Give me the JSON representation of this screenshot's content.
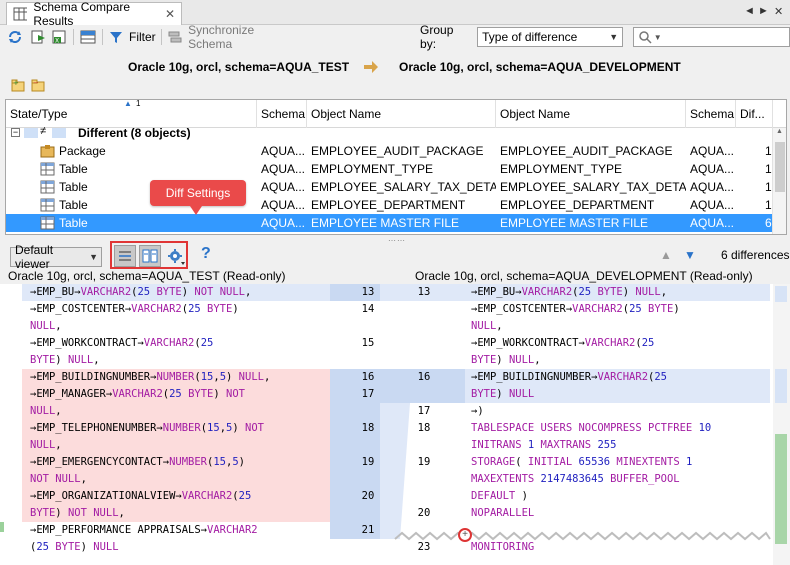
{
  "tab": {
    "title": "Schema Compare Results",
    "icon": "table-icon",
    "close": "✕"
  },
  "window_controls": {
    "prev": "◄",
    "next": "►",
    "close": "✕"
  },
  "toolbar": {
    "filter_label": "Filter",
    "sync_label": "Synchronize Schema",
    "group_by_label": "Group by:",
    "group_by_value": "Type of difference",
    "search_placeholder": ""
  },
  "connections": {
    "left": "Oracle 10g, orcl,  schema=AQUA_TEST",
    "right": "Oracle 10g, orcl,  schema=AQUA_DEVELOPMENT"
  },
  "grid": {
    "sort_indicator": "1",
    "columns": [
      "State/Type",
      "Schema",
      "Object Name",
      "Object Name",
      "Schema",
      "Dif..."
    ],
    "group": {
      "label": "Different (8 objects)"
    },
    "rows": [
      {
        "type": "Package",
        "schema": "AQUA...",
        "left": "EMPLOYEE_AUDIT_PACKAGE",
        "right": "EMPLOYEE_AUDIT_PACKAGE",
        "schema2": "AQUA...",
        "diff": "1"
      },
      {
        "type": "Table",
        "schema": "AQUA...",
        "left": "EMPLOYMENT_TYPE",
        "right": "EMPLOYMENT_TYPE",
        "schema2": "AQUA...",
        "diff": "1"
      },
      {
        "type": "Table",
        "schema": "AQUA...",
        "left": "EMPLOYEE_SALARY_TAX_DETAILS",
        "right": "EMPLOYEE_SALARY_TAX_DETAILS",
        "schema2": "AQUA...",
        "diff": "1"
      },
      {
        "type": "Table",
        "schema": "AQUA...",
        "left": "EMPLOYEE_DEPARTMENT",
        "right": "EMPLOYEE_DEPARTMENT",
        "schema2": "AQUA...",
        "diff": "1"
      },
      {
        "type": "Table",
        "schema": "AQUA...",
        "left": "EMPLOYEE MASTER FILE",
        "right": "EMPLOYEE MASTER FILE",
        "schema2": "AQUA...",
        "diff": "6"
      }
    ]
  },
  "callout": {
    "label": "Diff Settings"
  },
  "viewer": {
    "select_value": "Default viewer",
    "help": "?",
    "differences": "6 differences"
  },
  "panes": {
    "left_header": "Oracle 10g, orcl, schema=AQUA_TEST (Read-only)",
    "right_header": "Oracle 10g, orcl, schema=AQUA_DEVELOPMENT (Read-only)"
  },
  "diff": {
    "left_lines": [
      [
        [
          "→EMP_BU→",
          "pl"
        ],
        [
          "VARCHAR2",
          "kw"
        ],
        [
          "(",
          "pl"
        ],
        [
          "25",
          "nm"
        ],
        [
          " BYTE",
          "kw"
        ],
        [
          ") ",
          "pl"
        ],
        [
          "NOT NULL",
          "kw"
        ],
        [
          ",",
          "pl"
        ]
      ],
      [
        [
          "→EMP_COSTCENTER→",
          "pl"
        ],
        [
          "VARCHAR2",
          "kw"
        ],
        [
          "(",
          "pl"
        ],
        [
          "25",
          "nm"
        ],
        [
          " BYTE",
          "kw"
        ],
        [
          ")",
          "pl"
        ]
      ],
      [
        [
          "NULL",
          "kw"
        ],
        [
          ",",
          "pl"
        ]
      ],
      [
        [
          "→EMP_WORKCONTRACT→",
          "pl"
        ],
        [
          "VARCHAR2",
          "kw"
        ],
        [
          "(",
          "pl"
        ],
        [
          "25",
          "nm"
        ]
      ],
      [
        [
          "BYTE",
          "kw"
        ],
        [
          ") ",
          "pl"
        ],
        [
          "NULL",
          "kw"
        ],
        [
          ",",
          "pl"
        ]
      ],
      [
        [
          "→EMP_BUILDINGNUMBER→",
          "pl"
        ],
        [
          "NUMBER",
          "kw"
        ],
        [
          "(",
          "pl"
        ],
        [
          "15",
          "nm"
        ],
        [
          ",",
          "pl"
        ],
        [
          "5",
          "nm"
        ],
        [
          ") ",
          "pl"
        ],
        [
          "NULL",
          "kw"
        ],
        [
          ",",
          "pl"
        ]
      ],
      [
        [
          "→EMP_MANAGER→",
          "pl"
        ],
        [
          "VARCHAR2",
          "kw"
        ],
        [
          "(",
          "pl"
        ],
        [
          "25",
          "nm"
        ],
        [
          " BYTE",
          "kw"
        ],
        [
          ") ",
          "pl"
        ],
        [
          "NOT",
          "kw"
        ]
      ],
      [
        [
          "NULL",
          "kw"
        ],
        [
          ",",
          "pl"
        ]
      ],
      [
        [
          "→EMP_TELEPHONENUMBER→",
          "pl"
        ],
        [
          "NUMBER",
          "kw"
        ],
        [
          "(",
          "pl"
        ],
        [
          "15",
          "nm"
        ],
        [
          ",",
          "pl"
        ],
        [
          "5",
          "nm"
        ],
        [
          ") ",
          "pl"
        ],
        [
          "NOT",
          "kw"
        ]
      ],
      [
        [
          "NULL",
          "kw"
        ],
        [
          ",",
          "pl"
        ]
      ],
      [
        [
          "→EMP_EMERGENCYCONTACT→",
          "pl"
        ],
        [
          "NUMBER",
          "kw"
        ],
        [
          "(",
          "pl"
        ],
        [
          "15",
          "nm"
        ],
        [
          ",",
          "pl"
        ],
        [
          "5",
          "nm"
        ],
        [
          ")",
          "pl"
        ]
      ],
      [
        [
          "NOT NULL",
          "kw"
        ],
        [
          ",",
          "pl"
        ]
      ],
      [
        [
          "→EMP_ORGANIZATIONALVIEW→",
          "pl"
        ],
        [
          "VARCHAR2",
          "kw"
        ],
        [
          "(",
          "pl"
        ],
        [
          "25",
          "nm"
        ]
      ],
      [
        [
          "BYTE",
          "kw"
        ],
        [
          ") ",
          "pl"
        ],
        [
          "NOT NULL",
          "kw"
        ],
        [
          ",",
          "pl"
        ]
      ],
      [
        [
          "→EMP_PERFORMANCE APPRAISALS→",
          "pl"
        ],
        [
          "VARCHAR2",
          "kw"
        ]
      ],
      [
        [
          "(",
          "pl"
        ],
        [
          "25",
          "nm"
        ],
        [
          " BYTE",
          "kw"
        ],
        [
          ") ",
          "pl"
        ],
        [
          "NULL",
          "kw"
        ]
      ]
    ],
    "left_numbers": [
      "13",
      "14",
      "",
      "15",
      "",
      "16",
      "17",
      "",
      "18",
      "",
      "19",
      "",
      "20",
      "",
      "21",
      ""
    ],
    "right_numbers": [
      "13",
      "",
      "",
      "",
      "",
      "16",
      "",
      "17",
      "18",
      "",
      "19",
      "",
      "",
      "20",
      "",
      "23"
    ],
    "right_lines": [
      [
        [
          "→EMP_BU→",
          "pl"
        ],
        [
          "VARCHAR2",
          "kw"
        ],
        [
          "(",
          "pl"
        ],
        [
          "25",
          "nm"
        ],
        [
          " BYTE",
          "kw"
        ],
        [
          ") ",
          "pl"
        ],
        [
          "NULL",
          "kw"
        ],
        [
          ",",
          "pl"
        ]
      ],
      [
        [
          "→EMP_COSTCENTER→",
          "pl"
        ],
        [
          "VARCHAR2",
          "kw"
        ],
        [
          "(",
          "pl"
        ],
        [
          "25",
          "nm"
        ],
        [
          " BYTE",
          "kw"
        ],
        [
          ")",
          "pl"
        ]
      ],
      [
        [
          "NULL",
          "kw"
        ],
        [
          ",",
          "pl"
        ]
      ],
      [
        [
          "→EMP_WORKCONTRACT→",
          "pl"
        ],
        [
          "VARCHAR2",
          "kw"
        ],
        [
          "(",
          "pl"
        ],
        [
          "25",
          "nm"
        ]
      ],
      [
        [
          "BYTE",
          "kw"
        ],
        [
          ") ",
          "pl"
        ],
        [
          "NULL",
          "kw"
        ],
        [
          ",",
          "pl"
        ]
      ],
      [
        [
          "→EMP_BUILDINGNUMBER→",
          "pl"
        ],
        [
          "VARCHAR2",
          "kw"
        ],
        [
          "(",
          "pl"
        ],
        [
          "25",
          "nm"
        ]
      ],
      [
        [
          "BYTE",
          "kw"
        ],
        [
          ") ",
          "pl"
        ],
        [
          "NULL",
          "kw"
        ]
      ],
      [
        [
          "→)",
          "pl"
        ]
      ],
      [
        [
          "TABLESPACE USERS NOCOMPRESS PCTFREE ",
          "kw"
        ],
        [
          "10",
          "nm"
        ]
      ],
      [
        [
          "INITRANS ",
          "kw"
        ],
        [
          "1",
          "nm"
        ],
        [
          " MAXTRANS ",
          "kw"
        ],
        [
          "255",
          "nm"
        ]
      ],
      [
        [
          "STORAGE",
          "kw"
        ],
        [
          "( ",
          "pl"
        ],
        [
          "INITIAL ",
          "kw"
        ],
        [
          "65536",
          "nm"
        ],
        [
          " MINEXTENTS ",
          "kw"
        ],
        [
          "1",
          "nm"
        ]
      ],
      [
        [
          "MAXEXTENTS ",
          "kw"
        ],
        [
          "2147483645",
          "nm"
        ],
        [
          " BUFFER_POOL",
          "kw"
        ]
      ],
      [
        [
          "DEFAULT",
          "kw"
        ],
        [
          " )",
          "pl"
        ]
      ],
      [
        [
          "NOPARALLEL",
          "kw"
        ]
      ],
      [
        [
          "",
          "pl"
        ]
      ],
      [
        [
          "MONITORING",
          "kw"
        ]
      ]
    ]
  }
}
